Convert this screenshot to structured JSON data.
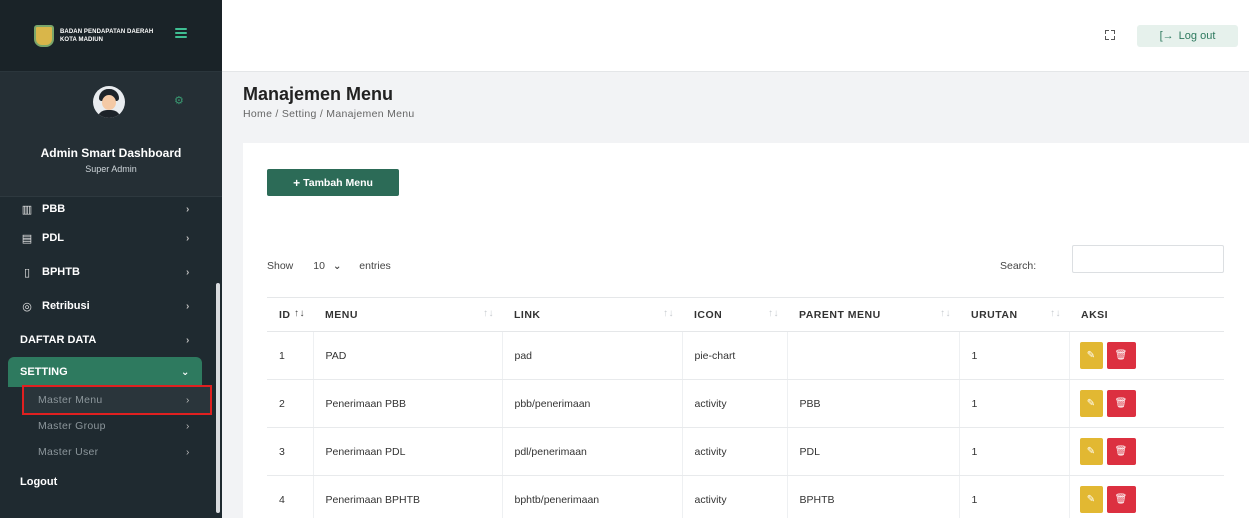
{
  "brand": {
    "line1": "BADAN PENDAPATAN DAERAH",
    "line2": "KOTA MADIUN"
  },
  "profile": {
    "name": "Admin Smart Dashboard",
    "role": "Super Admin"
  },
  "sidebar": {
    "items": [
      {
        "label": "PBB",
        "icon": "bar-chart-icon"
      },
      {
        "label": "PDL",
        "icon": "store-icon"
      },
      {
        "label": "BPHTB",
        "icon": "file-icon"
      },
      {
        "label": "Retribusi",
        "icon": "eye-icon"
      },
      {
        "label": "DAFTAR DATA"
      },
      {
        "label": "SETTING"
      }
    ],
    "setting_sub": [
      "Master Menu",
      "Master Group",
      "Master User"
    ],
    "logout": "Logout"
  },
  "topbar": {
    "logout": "Log out"
  },
  "page": {
    "title": "Manajemen Menu",
    "breadcrumb": "Home / Setting / Manajemen Menu"
  },
  "toolbar": {
    "add_label": "Tambah Menu",
    "show_label": "Show",
    "entries_label": "entries",
    "page_size": "10",
    "search_label": "Search:"
  },
  "table": {
    "columns": [
      "ID",
      "MENU",
      "LINK",
      "ICON",
      "PARENT MENU",
      "URUTAN",
      "AKSI"
    ],
    "rows": [
      {
        "id": "1",
        "menu": "PAD",
        "link": "pad",
        "icon": "pie-chart",
        "parent": "",
        "urutan": "1"
      },
      {
        "id": "2",
        "menu": "Penerimaan PBB",
        "link": "pbb/penerimaan",
        "icon": "activity",
        "parent": "PBB",
        "urutan": "1"
      },
      {
        "id": "3",
        "menu": "Penerimaan PDL",
        "link": "pdl/penerimaan",
        "icon": "activity",
        "parent": "PDL",
        "urutan": "1"
      },
      {
        "id": "4",
        "menu": "Penerimaan BPHTB",
        "link": "bphtb/penerimaan",
        "icon": "activity",
        "parent": "BPHTB",
        "urutan": "1"
      }
    ]
  },
  "colors": {
    "sidebar_bg": "#1f2a30",
    "accent": "#2e7a5f",
    "edit": "#e2b832",
    "delete": "#dc3040"
  }
}
